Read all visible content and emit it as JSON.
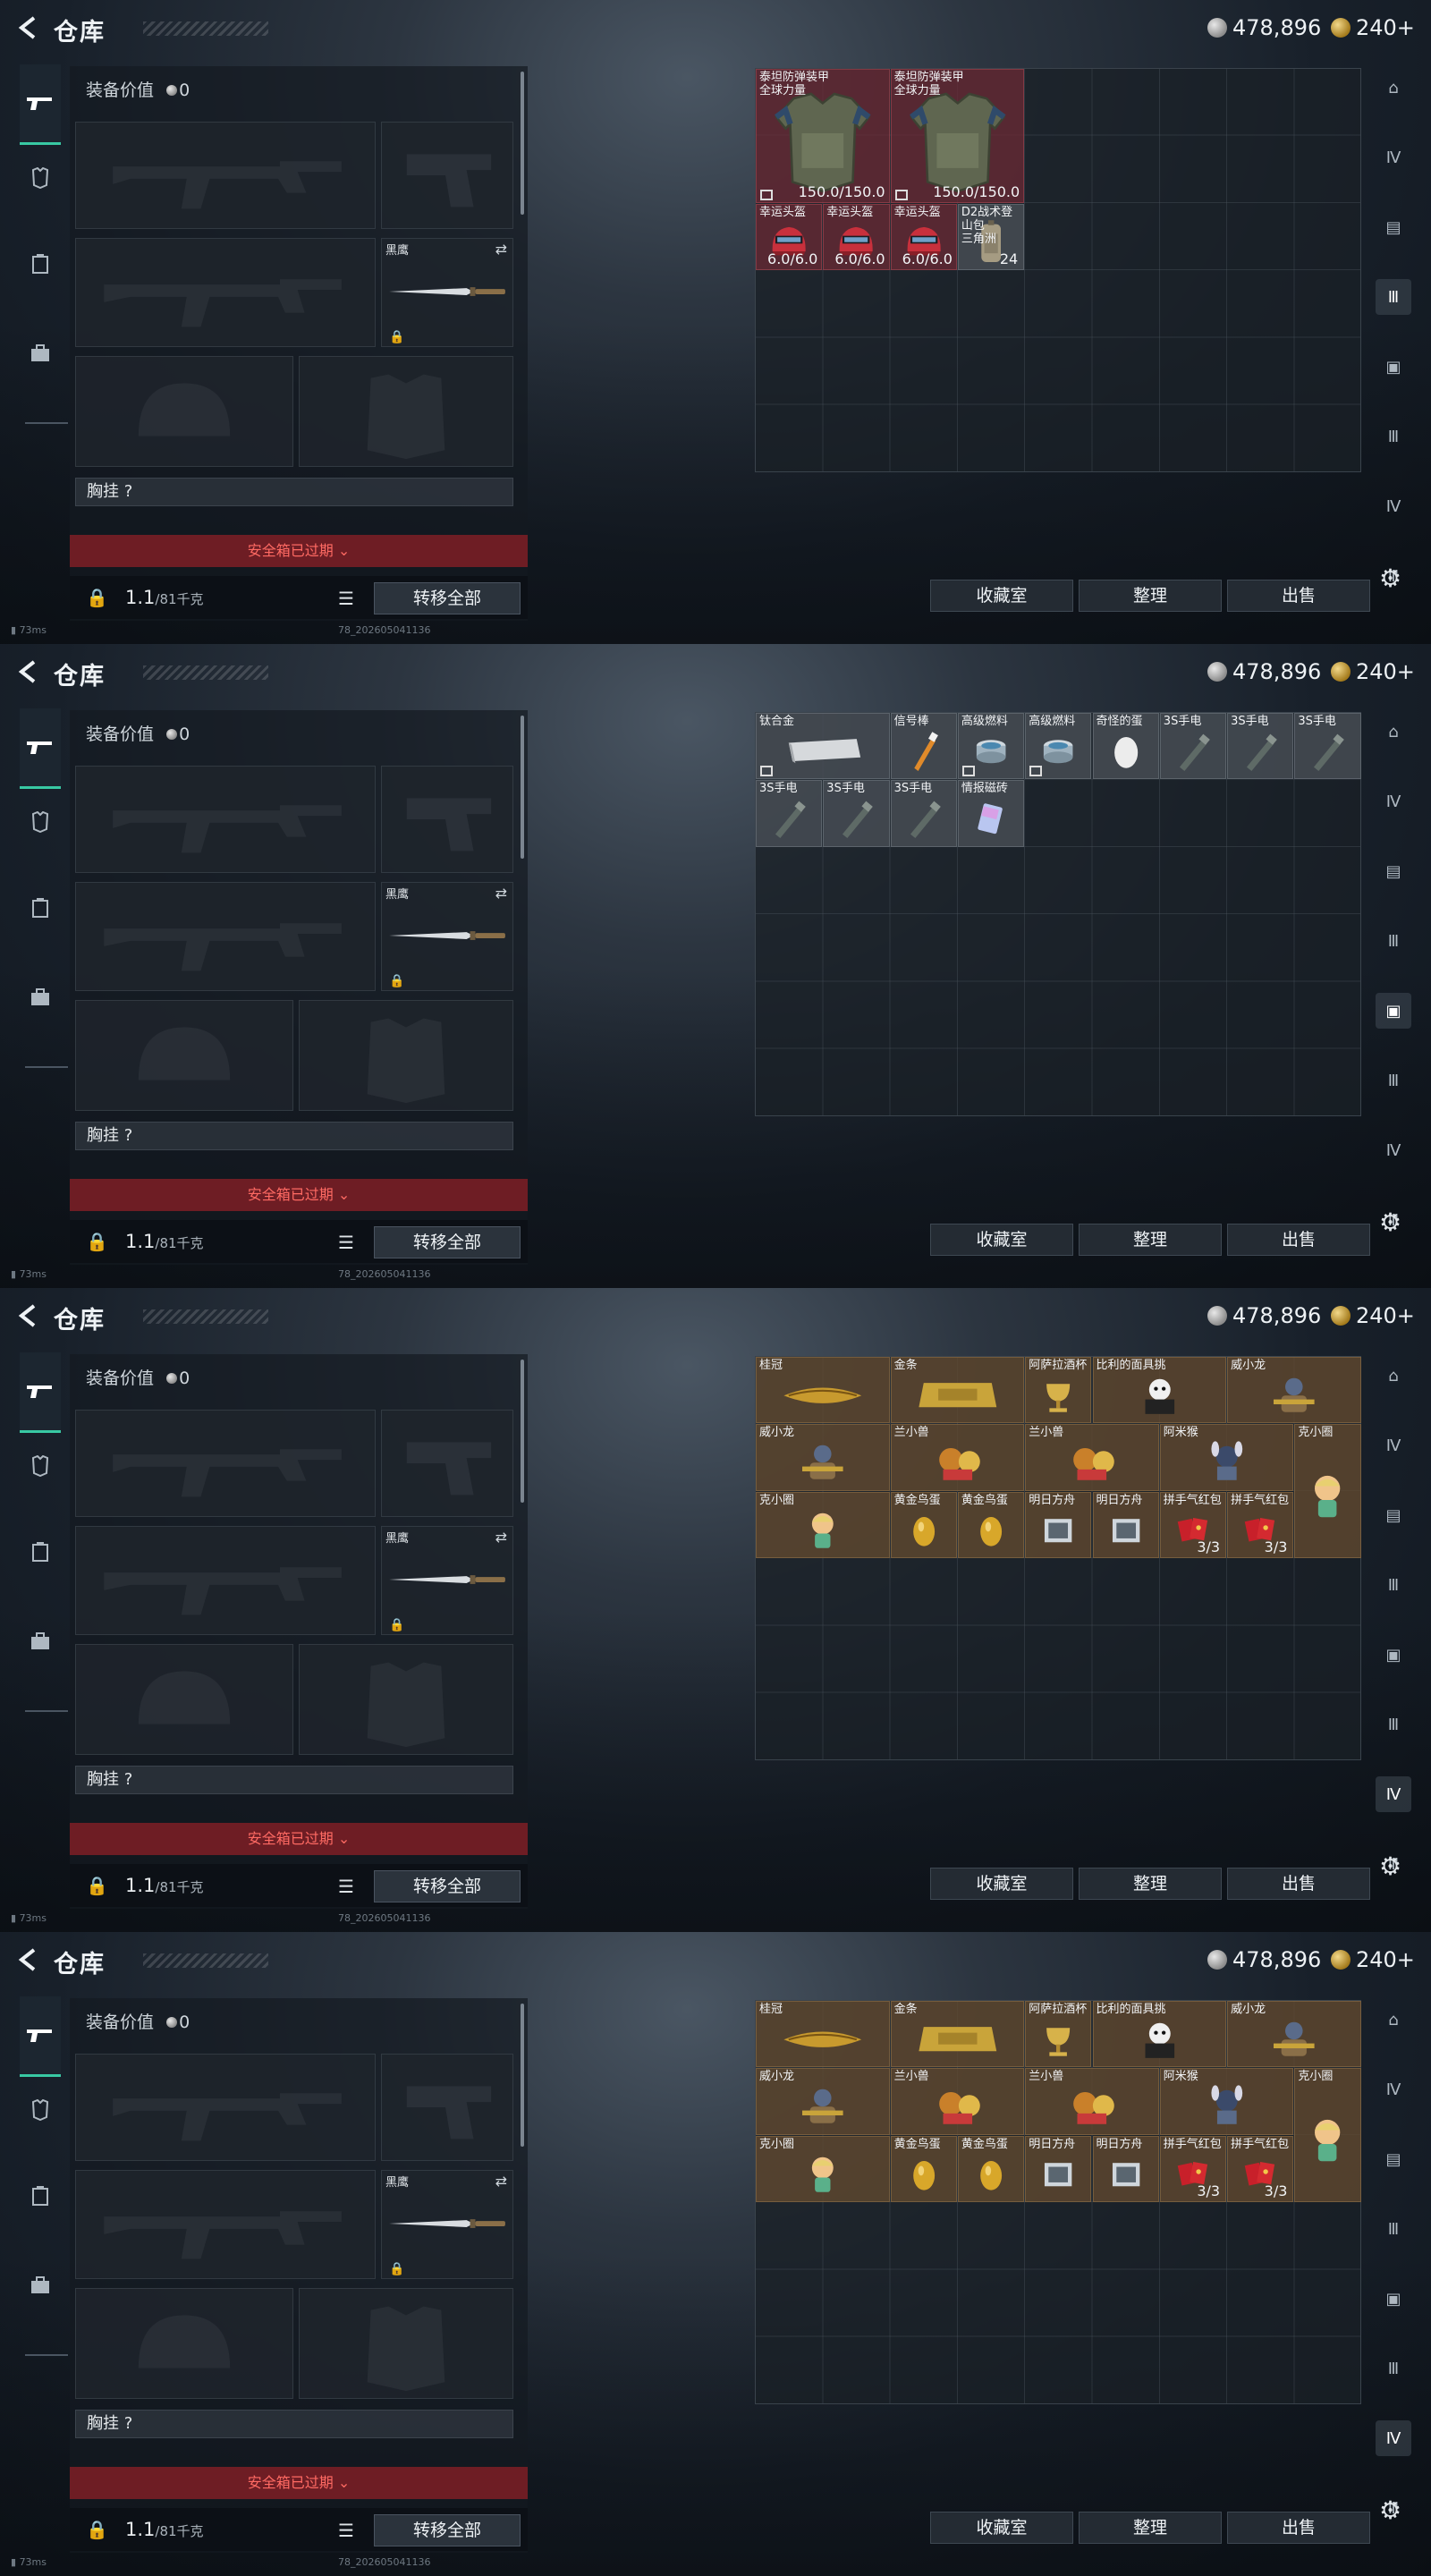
{
  "header": {
    "back_label": "ᐸ",
    "title": "仓库",
    "silver": "478,896",
    "gold": "240+"
  },
  "equipment": {
    "value_label": "装备价值",
    "value": "0",
    "knife_label": "黑鹰",
    "vest_label": "胸挂",
    "vest_value": "?",
    "expired_label": "安全箱已过期",
    "weight_value": "1.1",
    "weight_capacity": "/81千克",
    "transfer_label": "转移全部"
  },
  "status": {
    "ping": "73ms",
    "build": "78_202605041136"
  },
  "actions": {
    "collection": "收藏室",
    "sort": "整理",
    "sell": "出售"
  },
  "colors": {
    "accent": "#38c9a3",
    "expired": "#6e1d24",
    "expired_text": "#ff6a63"
  },
  "stash_tabs": [
    {
      "items": [
        {
          "name": "泰坦防弹装甲\n全球力量",
          "dur": "150.0/150.0",
          "icon": "armor-vest",
          "rarity": "red",
          "tag": true
        },
        {
          "name": "泰坦防弹装甲\n全球力量",
          "dur": "150.0/150.0",
          "icon": "armor-vest",
          "rarity": "red",
          "tag": true
        },
        {
          "name": "幸运头盔",
          "dur": "6.0/6.0",
          "icon": "helmet",
          "rarity": "red"
        },
        {
          "name": "幸运头盔",
          "dur": "6.0/6.0",
          "icon": "helmet",
          "rarity": "red"
        },
        {
          "name": "幸运头盔",
          "dur": "6.0/6.0",
          "icon": "helmet",
          "rarity": "red"
        },
        {
          "name": "D2战术登山包\n三角洲",
          "count": "24",
          "icon": "backpack",
          "rarity": "gray"
        }
      ]
    },
    {
      "items": [
        {
          "name": "钛合金",
          "icon": "ingot",
          "rarity": "gray",
          "tag": true
        },
        {
          "name": "信号棒",
          "icon": "flare",
          "rarity": "gray"
        },
        {
          "name": "高级燃料",
          "icon": "can",
          "rarity": "gray",
          "tag": true
        },
        {
          "name": "高级燃料",
          "icon": "can",
          "rarity": "gray",
          "tag": true
        },
        {
          "name": "奇怪的蛋",
          "icon": "egg",
          "rarity": "gray"
        },
        {
          "name": "3S手电",
          "icon": "flashlight",
          "rarity": "gray"
        },
        {
          "name": "3S手电",
          "icon": "flashlight",
          "rarity": "gray"
        },
        {
          "name": "3S手电",
          "icon": "flashlight",
          "rarity": "gray"
        },
        {
          "name": "3S手电",
          "icon": "flashlight",
          "rarity": "gray"
        },
        {
          "name": "3S手电",
          "icon": "flashlight",
          "rarity": "gray"
        },
        {
          "name": "3S手电",
          "icon": "flashlight",
          "rarity": "gray"
        },
        {
          "name": "情报磁砖",
          "icon": "card",
          "rarity": "gray"
        }
      ]
    },
    {
      "items": [
        {
          "name": "桂冠",
          "icon": "laurel",
          "rarity": "goldbg"
        },
        {
          "name": "金条",
          "icon": "goldbar",
          "rarity": "goldbg"
        },
        {
          "name": "阿萨拉酒杯",
          "icon": "goblet",
          "rarity": "goldbg"
        },
        {
          "name": "比利的面具挑",
          "icon": "puppet",
          "rarity": "goldbg"
        },
        {
          "name": "威小龙",
          "icon": "figure",
          "rarity": "goldbg"
        },
        {
          "name": "威小龙",
          "icon": "figure",
          "rarity": "goldbg"
        },
        {
          "name": "兰小兽",
          "icon": "beast",
          "rarity": "goldbg"
        },
        {
          "name": "兰小兽",
          "icon": "beast",
          "rarity": "goldbg"
        },
        {
          "name": "阿米猴",
          "icon": "monkey",
          "rarity": "goldbg"
        },
        {
          "name": "克小圈",
          "icon": "doll",
          "rarity": "goldbg"
        },
        {
          "name": "克小圈",
          "icon": "doll",
          "rarity": "goldbg"
        },
        {
          "name": "黄金鸟蛋",
          "icon": "goldegg",
          "rarity": "goldbg"
        },
        {
          "name": "黄金鸟蛋",
          "icon": "goldegg",
          "rarity": "goldbg"
        },
        {
          "name": "明日方舟",
          "icon": "box",
          "rarity": "goldbg"
        },
        {
          "name": "明日方舟",
          "icon": "box",
          "rarity": "goldbg"
        },
        {
          "name": "拼手气红包",
          "count": "3/3",
          "icon": "redpacket",
          "rarity": "goldbg"
        },
        {
          "name": "拼手气红包",
          "count": "3/3",
          "icon": "redpacket",
          "rarity": "goldbg"
        }
      ]
    },
    {
      "items": [
        {
          "name": "桂冠",
          "icon": "laurel",
          "rarity": "goldbg"
        },
        {
          "name": "金条",
          "icon": "goldbar",
          "rarity": "goldbg"
        },
        {
          "name": "阿萨拉酒杯",
          "icon": "goblet",
          "rarity": "goldbg"
        },
        {
          "name": "比利的面具挑",
          "icon": "puppet",
          "rarity": "goldbg"
        },
        {
          "name": "威小龙",
          "icon": "figure",
          "rarity": "goldbg"
        },
        {
          "name": "威小龙",
          "icon": "figure",
          "rarity": "goldbg"
        },
        {
          "name": "兰小兽",
          "icon": "beast",
          "rarity": "goldbg"
        },
        {
          "name": "兰小兽",
          "icon": "beast",
          "rarity": "goldbg"
        },
        {
          "name": "阿米猴",
          "icon": "monkey",
          "rarity": "goldbg"
        },
        {
          "name": "克小圈",
          "icon": "doll",
          "rarity": "goldbg"
        },
        {
          "name": "克小圈",
          "icon": "doll",
          "rarity": "goldbg"
        },
        {
          "name": "黄金鸟蛋",
          "icon": "goldegg",
          "rarity": "goldbg"
        },
        {
          "name": "黄金鸟蛋",
          "icon": "goldegg",
          "rarity": "goldbg"
        },
        {
          "name": "明日方舟",
          "icon": "box",
          "rarity": "goldbg"
        },
        {
          "name": "明日方舟",
          "icon": "box",
          "rarity": "goldbg"
        },
        {
          "name": "拼手气红包",
          "count": "3/3",
          "icon": "redpacket",
          "rarity": "goldbg"
        },
        {
          "name": "拼手气红包",
          "count": "3/3",
          "icon": "redpacket",
          "rarity": "goldbg"
        }
      ]
    }
  ]
}
